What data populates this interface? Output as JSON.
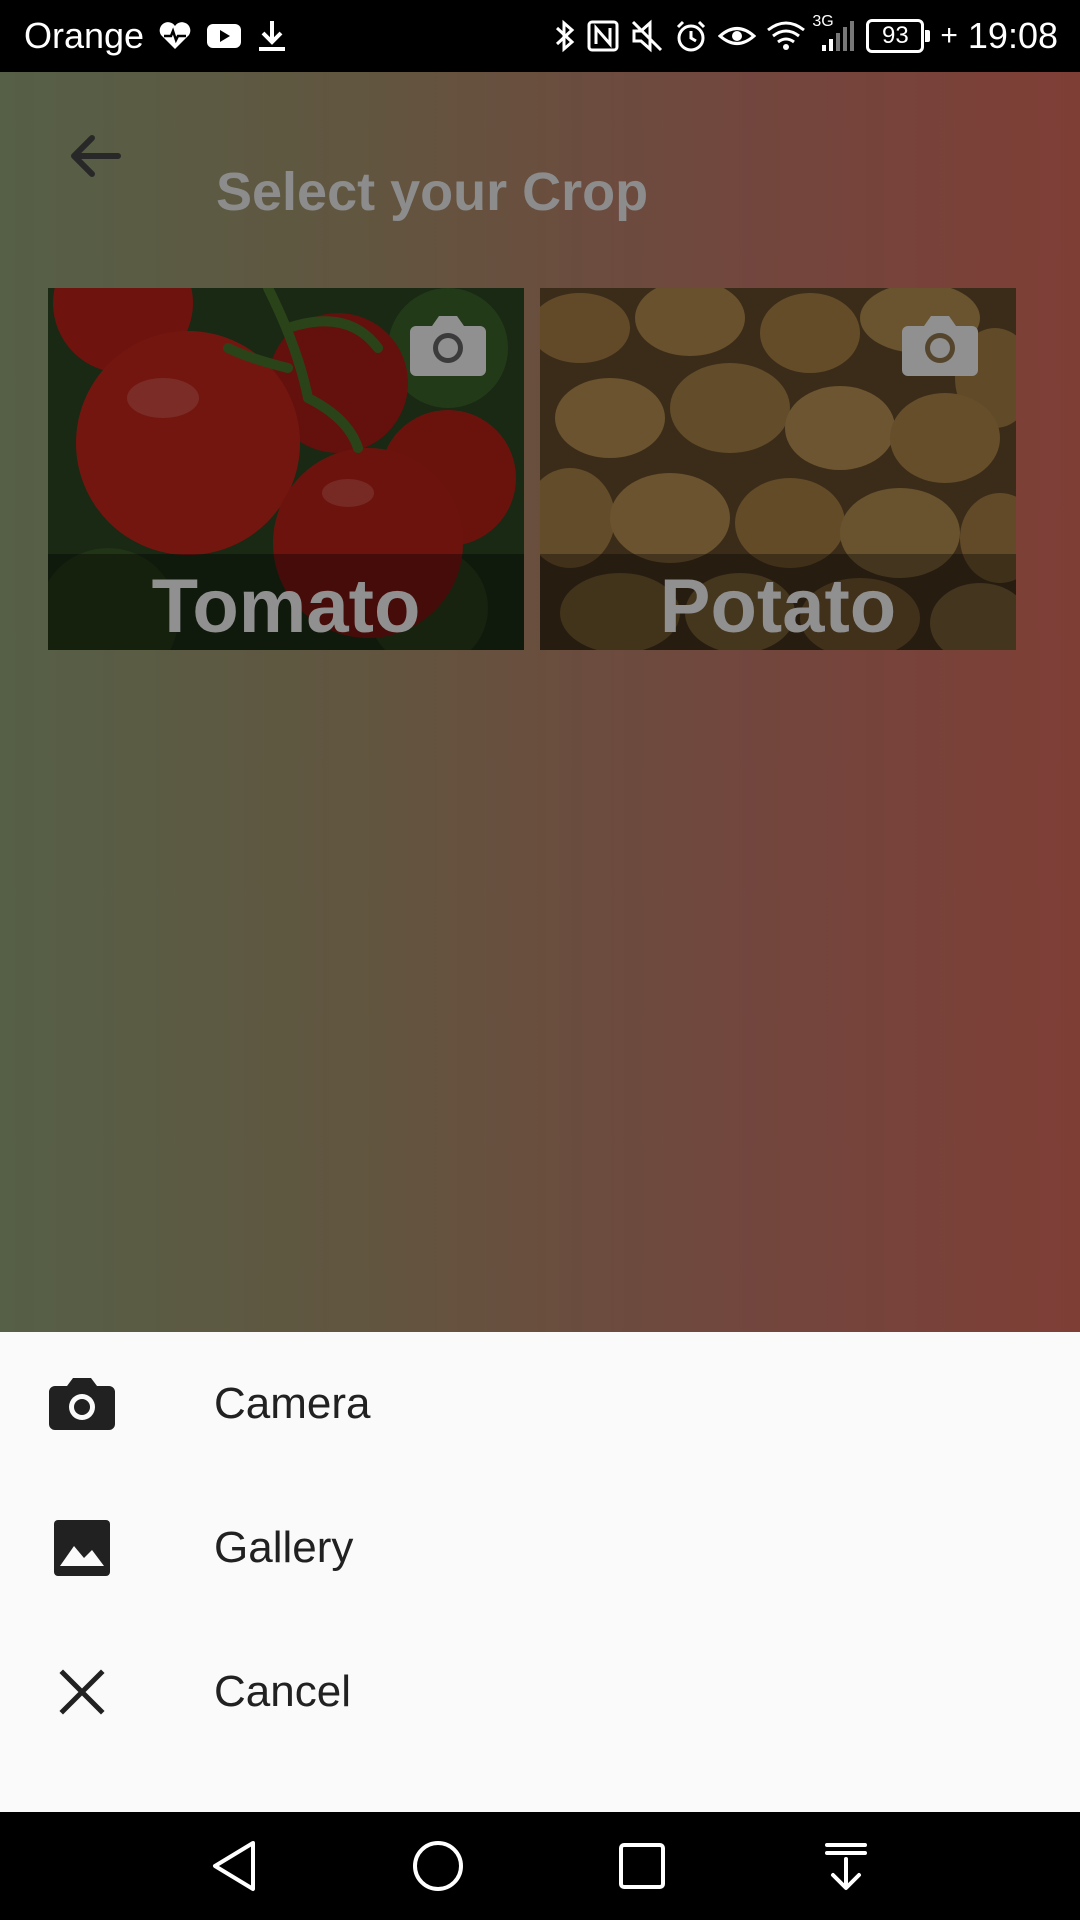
{
  "status_bar": {
    "carrier": "Orange",
    "network": "3G",
    "battery": "93",
    "time": "19:08"
  },
  "topbar": {
    "title": "Select your Crop"
  },
  "crops": [
    {
      "label": "Tomato"
    },
    {
      "label": "Potato"
    }
  ],
  "sheet": {
    "items": [
      {
        "label": "Camera",
        "icon": "camera-icon"
      },
      {
        "label": "Gallery",
        "icon": "image-icon"
      },
      {
        "label": "Cancel",
        "icon": "close-icon"
      }
    ]
  },
  "colors": {
    "gradient_left": "#7b8a66",
    "gradient_right": "#b55a4e",
    "sheet_bg": "#fafafa"
  }
}
